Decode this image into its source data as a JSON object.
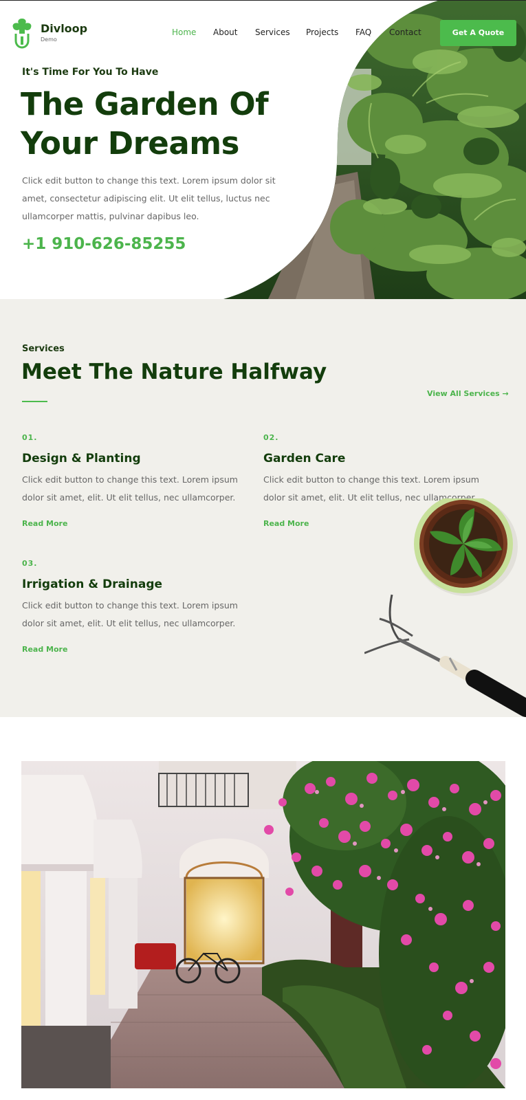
{
  "brand": {
    "name": "Divloop",
    "tagline": "Demo"
  },
  "nav": {
    "items": [
      {
        "label": "Home",
        "active": true
      },
      {
        "label": "About"
      },
      {
        "label": "Services"
      },
      {
        "label": "Projects"
      },
      {
        "label": "FAQ"
      },
      {
        "label": "Contact"
      }
    ],
    "cta": "Get A Quote"
  },
  "hero": {
    "eyebrow": "It's Time For You To Have",
    "title_line1": "The Garden Of",
    "title_line2": "Your Dreams",
    "text": "Click edit button to change this text. Lorem ipsum dolor sit amet, consectetur adipiscing elit. Ut elit tellus, luctus nec ullamcorper mattis, pulvinar dapibus leo.",
    "phone": "+1 910-626-85255"
  },
  "services": {
    "eyebrow": "Services",
    "title": "Meet The Nature Halfway",
    "view_all": "View All Services →",
    "items": [
      {
        "number": "01.",
        "title": "Design & Planting",
        "text": "Click edit button to change this text. Lorem ipsum dolor sit amet, elit. Ut elit tellus, nec ullamcorper.",
        "link": "Read More"
      },
      {
        "number": "02.",
        "title": "Garden Care",
        "text": "Click edit button to change this text. Lorem ipsum dolor sit amet, elit. Ut elit tellus, nec ullamcorper.",
        "link": "Read More"
      },
      {
        "number": "03.",
        "title": "Irrigation & Drainage",
        "text": "Click edit button to change this text. Lorem ipsum dolor sit amet, elit. Ut elit tellus, nec ullamcorper.",
        "link": "Read More"
      }
    ]
  },
  "colors": {
    "accent": "#4cbb4c",
    "heading": "#133d0c",
    "body_text": "#666666",
    "services_bg": "#f1f0eb"
  },
  "icons": {
    "logo": "leaf-plug-icon",
    "arrow": "arrow-right-icon"
  }
}
